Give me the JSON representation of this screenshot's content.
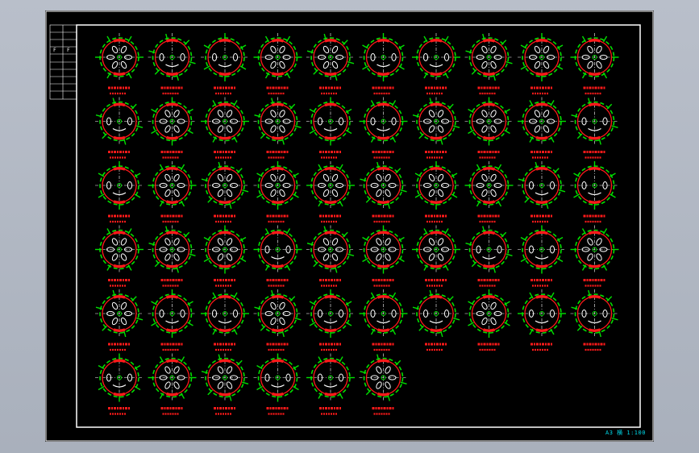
{
  "drawing": {
    "background": "#000000",
    "border_color": "#ffffff",
    "sheet_info": "A3 横 1:100",
    "title_block_marks": [
      "F",
      "F"
    ],
    "colors": {
      "outline": "#00e000",
      "section": "#ff1a1a",
      "hole": "#ffffff",
      "centerline": "#ffffff",
      "label": "#ff1a1a"
    },
    "rows": 6,
    "columns": 10,
    "detail_count": 56,
    "details": [
      "sixhole",
      "twohole",
      "twohole",
      "sixhole",
      "sixhole",
      "twohole",
      "twohole",
      "sixhole",
      "sixhole",
      "sixhole",
      "twohole",
      "sixhole",
      "sixhole",
      "sixhole",
      "twohole",
      "twohole",
      "sixhole",
      "sixhole",
      "sixhole",
      "twohole",
      "twohole",
      "sixhole",
      "sixhole",
      "sixhole",
      "sixhole",
      "sixhole",
      "sixhole",
      "sixhole",
      "twohole",
      "twohole",
      "sixhole",
      "sixhole",
      "sixhole",
      "twohole",
      "sixhole",
      "sixhole",
      "sixhole",
      "twohole",
      "twohole",
      "sixhole",
      "sixhole",
      "twohole",
      "twohole",
      "sixhole",
      "twohole",
      "twohole",
      "twohole",
      "sixhole",
      "twohole",
      "twohole",
      "twohole",
      "sixhole",
      "sixhole",
      "twohole",
      "twohole",
      "sixhole"
    ]
  }
}
